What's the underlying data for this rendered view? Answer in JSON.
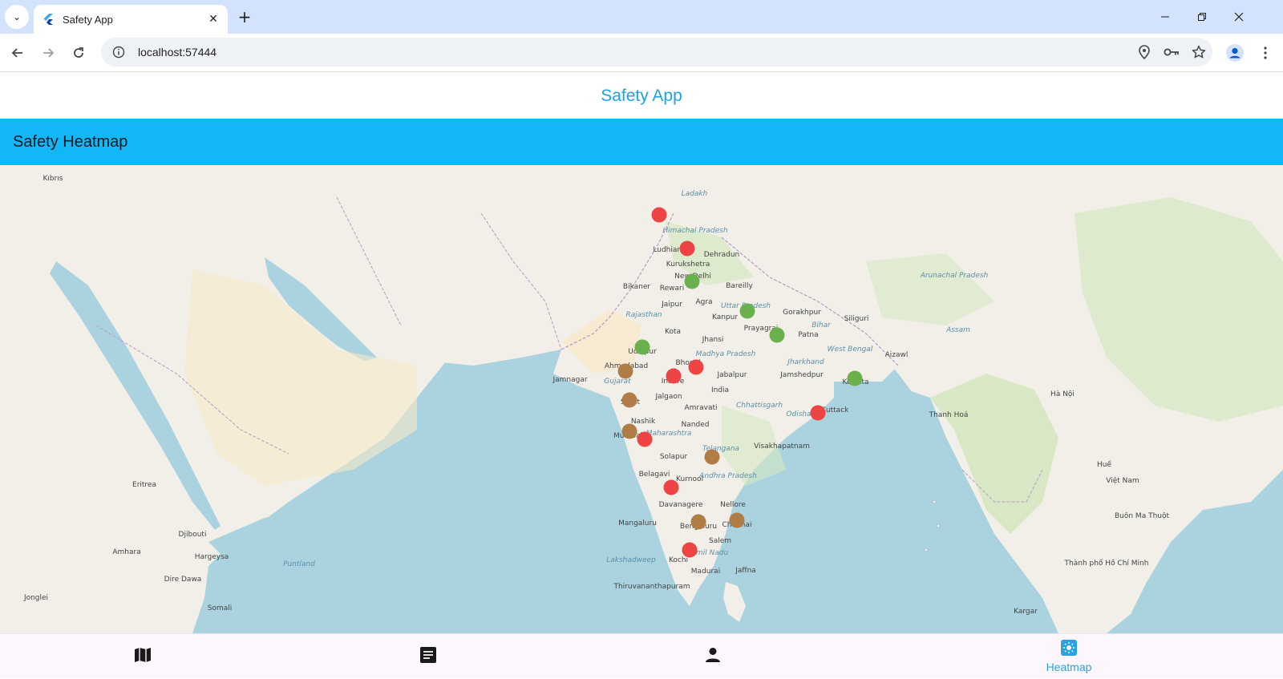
{
  "browser": {
    "tab_title": "Safety App",
    "url": "localhost:57444"
  },
  "app": {
    "title": "Safety App",
    "section_title": "Safety Heatmap"
  },
  "map": {
    "labels": [
      {
        "text": "Ludhiana",
        "cls": ""
      },
      {
        "text": "Dehradun",
        "cls": ""
      },
      {
        "text": "Kurukshetra",
        "cls": ""
      },
      {
        "text": "New Delhi",
        "cls": ""
      },
      {
        "text": "Bikaner",
        "cls": ""
      },
      {
        "text": "Rewari",
        "cls": ""
      },
      {
        "text": "Bareilly",
        "cls": ""
      },
      {
        "text": "Jaipur",
        "cls": ""
      },
      {
        "text": "Agra",
        "cls": ""
      },
      {
        "text": "Kanpur",
        "cls": ""
      },
      {
        "text": "Gorakhpur",
        "cls": ""
      },
      {
        "text": "Prayagraj",
        "cls": ""
      },
      {
        "text": "Patna",
        "cls": ""
      },
      {
        "text": "Siliguri",
        "cls": ""
      },
      {
        "text": "Kota",
        "cls": ""
      },
      {
        "text": "Jhansi",
        "cls": ""
      },
      {
        "text": "Udaipur",
        "cls": ""
      },
      {
        "text": "Ahmedabad",
        "cls": ""
      },
      {
        "text": "Bhopal",
        "cls": ""
      },
      {
        "text": "Jabalpur",
        "cls": ""
      },
      {
        "text": "Jamshedpur",
        "cls": ""
      },
      {
        "text": "Kolkata",
        "cls": ""
      },
      {
        "text": "Indore",
        "cls": ""
      },
      {
        "text": "India",
        "cls": ""
      },
      {
        "text": "Jamnagar",
        "cls": ""
      },
      {
        "text": "Surat",
        "cls": ""
      },
      {
        "text": "Jalgaon",
        "cls": ""
      },
      {
        "text": "Amravati",
        "cls": ""
      },
      {
        "text": "Cuttack",
        "cls": ""
      },
      {
        "text": "Odisha",
        "cls": "sea"
      },
      {
        "text": "Nashik",
        "cls": ""
      },
      {
        "text": "Nanded",
        "cls": ""
      },
      {
        "text": "Mumbai",
        "cls": ""
      },
      {
        "text": "Maharashtra",
        "cls": "sea"
      },
      {
        "text": "Visakhapatnam",
        "cls": ""
      },
      {
        "text": "Solapur",
        "cls": ""
      },
      {
        "text": "Belagavi",
        "cls": ""
      },
      {
        "text": "Kurnool",
        "cls": ""
      },
      {
        "text": "Davanagere",
        "cls": ""
      },
      {
        "text": "Nellore",
        "cls": ""
      },
      {
        "text": "Mangaluru",
        "cls": ""
      },
      {
        "text": "Bengaluru",
        "cls": ""
      },
      {
        "text": "Chennai",
        "cls": ""
      },
      {
        "text": "Salem",
        "cls": ""
      },
      {
        "text": "Kochi",
        "cls": ""
      },
      {
        "text": "Madurai",
        "cls": ""
      },
      {
        "text": "Jaffna",
        "cls": ""
      },
      {
        "text": "Thiruvananthapuram",
        "cls": ""
      },
      {
        "text": "Lakshadweep",
        "cls": "sea"
      },
      {
        "text": "Rajasthan",
        "cls": "sea"
      },
      {
        "text": "Uttar Pradesh",
        "cls": "sea"
      },
      {
        "text": "Bihar",
        "cls": "sea"
      },
      {
        "text": "West Bengal",
        "cls": "sea"
      },
      {
        "text": "Jharkhand",
        "cls": "sea"
      },
      {
        "text": "Chhattisgarh",
        "cls": "sea"
      },
      {
        "text": "Telangana",
        "cls": "sea"
      },
      {
        "text": "Andhra Pradesh",
        "cls": "sea"
      },
      {
        "text": "Tamil Nadu",
        "cls": "sea"
      },
      {
        "text": "Gujarat",
        "cls": "sea"
      },
      {
        "text": "Madhya Pradesh",
        "cls": "sea"
      },
      {
        "text": "Himachal Pradesh",
        "cls": "sea"
      },
      {
        "text": "Ladakh",
        "cls": "sea"
      },
      {
        "text": "Arunachal Pradesh",
        "cls": "sea"
      },
      {
        "text": "Assam",
        "cls": "sea"
      },
      {
        "text": "Aizawl",
        "cls": ""
      },
      {
        "text": "Djibouti",
        "cls": ""
      },
      {
        "text": "Hargeysa",
        "cls": ""
      },
      {
        "text": "Eritrea",
        "cls": ""
      },
      {
        "text": "Kıbrıs",
        "cls": ""
      },
      {
        "text": "Puntland",
        "cls": "sea"
      },
      {
        "text": "Dire Dawa",
        "cls": ""
      },
      {
        "text": "Somali",
        "cls": ""
      },
      {
        "text": "Amhara",
        "cls": ""
      },
      {
        "text": "Jonglei",
        "cls": ""
      },
      {
        "text": "Thanh Hoá",
        "cls": ""
      },
      {
        "text": "Hà Nội",
        "cls": ""
      },
      {
        "text": "Huế",
        "cls": ""
      },
      {
        "text": "Việt Nam",
        "cls": ""
      },
      {
        "text": "Buôn Ma Thuột",
        "cls": ""
      },
      {
        "text": "Thành phố Hồ Chí Minh",
        "cls": ""
      },
      {
        "text": "Kargar",
        "cls": ""
      }
    ],
    "markers": [
      {
        "color": "#ef4444"
      },
      {
        "color": "#ef4444"
      },
      {
        "color": "#6ab04c"
      },
      {
        "color": "#6ab04c"
      },
      {
        "color": "#6ab04c"
      },
      {
        "color": "#6ab04c"
      },
      {
        "color": "#b07d47"
      },
      {
        "color": "#ef4444"
      },
      {
        "color": "#ef4444"
      },
      {
        "color": "#6ab04c"
      },
      {
        "color": "#b07d47"
      },
      {
        "color": "#ef4444"
      },
      {
        "color": "#b07d47"
      },
      {
        "color": "#ef4444"
      },
      {
        "color": "#b07d47"
      },
      {
        "color": "#ef4444"
      },
      {
        "color": "#b07d47"
      },
      {
        "color": "#b07d47"
      },
      {
        "color": "#ef4444"
      }
    ]
  },
  "bottom_nav": {
    "heatmap_label": "Heatmap"
  }
}
